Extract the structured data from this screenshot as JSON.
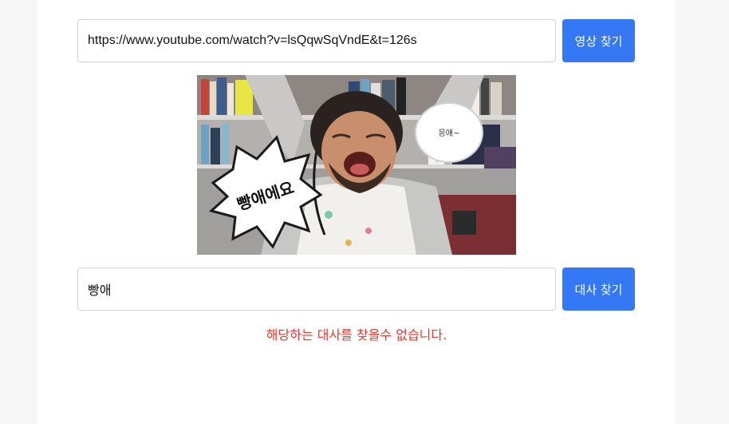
{
  "url_search": {
    "value": "https://www.youtube.com/watch?v=lsQqwSqVndE&t=126s",
    "button_label": "영상 찾기"
  },
  "thumbnail": {
    "caption_left": "빵애에요",
    "caption_right": "응애~"
  },
  "line_search": {
    "value": "빵애",
    "button_label": "대사 찾기"
  },
  "result": {
    "error_message": "해당하는 대사를 찾을수 없습니다."
  },
  "colors": {
    "accent": "#3478f6",
    "error": "#e03a2e"
  }
}
